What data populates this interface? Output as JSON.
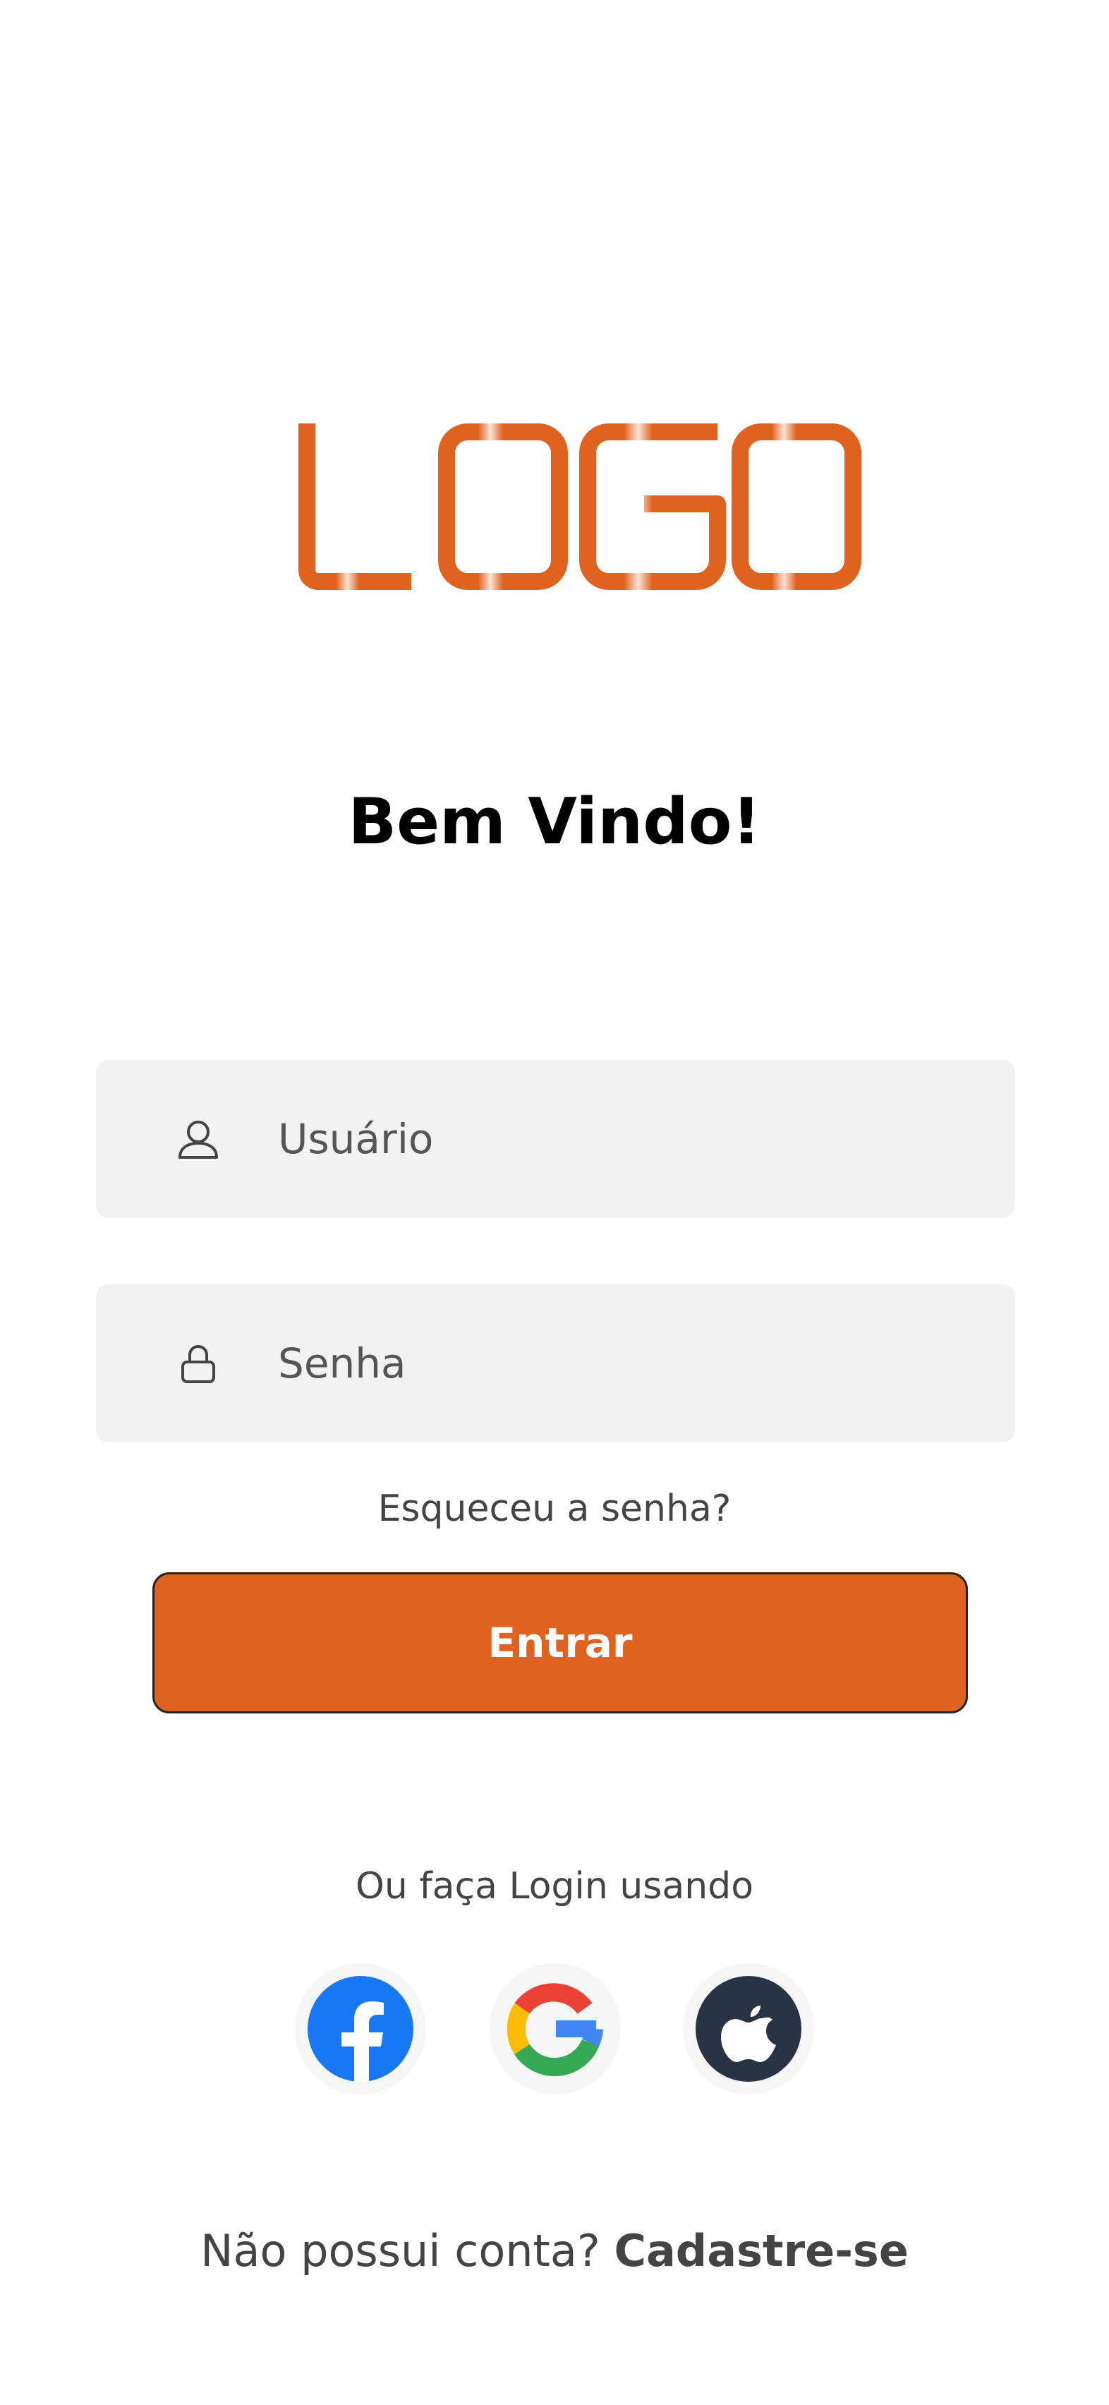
{
  "logo": {
    "text": "LOGO",
    "color": "#e0621f"
  },
  "welcome": {
    "title": "Bem Vindo!"
  },
  "form": {
    "username": {
      "placeholder": "Usuário",
      "icon": "user-icon"
    },
    "password": {
      "placeholder": "Senha",
      "icon": "lock-icon"
    },
    "forgot_label": "Esqueceu a senha?",
    "submit_label": "Entrar"
  },
  "social": {
    "prompt": "Ou faça Login usando",
    "providers": [
      {
        "name": "facebook",
        "icon": "facebook-icon",
        "color": "#1877f2"
      },
      {
        "name": "google",
        "icon": "google-icon",
        "color": "#4285f4"
      },
      {
        "name": "apple",
        "icon": "apple-icon",
        "color": "#283444"
      }
    ]
  },
  "signup": {
    "prompt": "Não possui conta?",
    "link": "Cadastre-se"
  },
  "colors": {
    "accent": "#e0621f",
    "field_bg": "#f2f2f2",
    "text_muted": "#444444"
  }
}
